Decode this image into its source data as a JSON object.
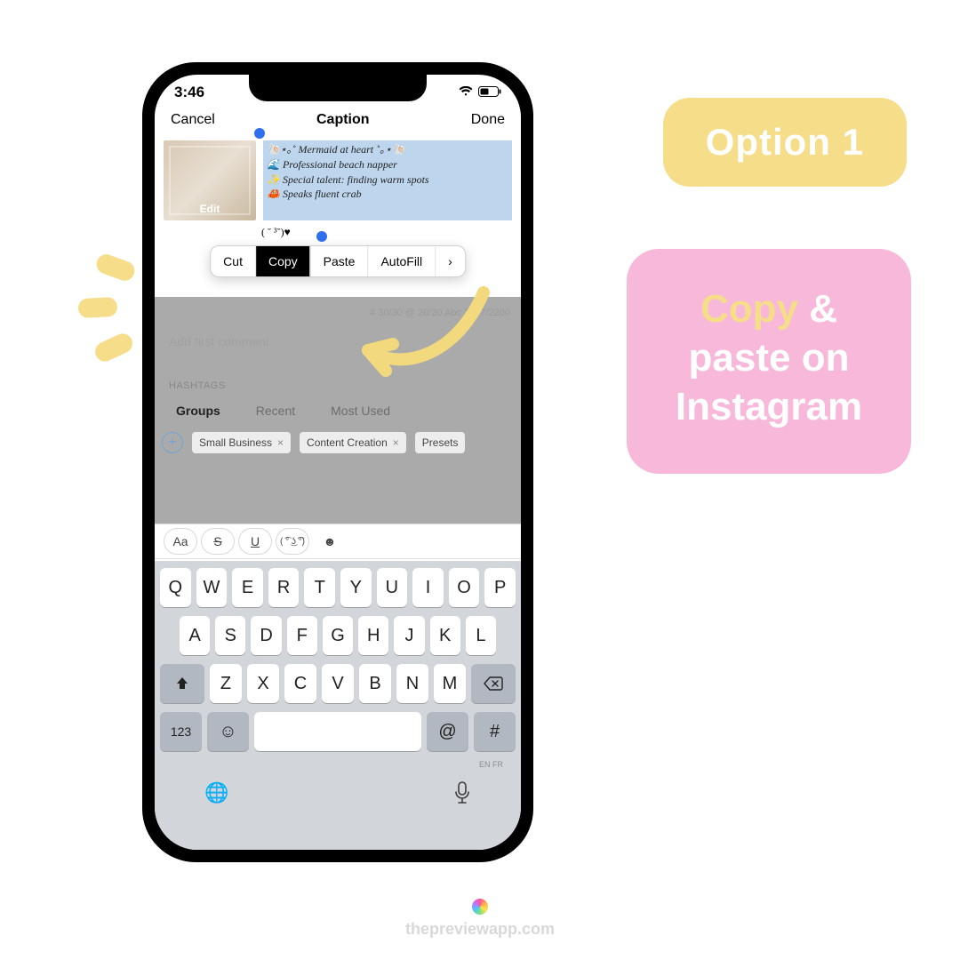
{
  "decor": {
    "badge": "Option 1",
    "pink": {
      "copy": "Copy",
      "amp": "&",
      "rest": "paste on Instagram"
    }
  },
  "status": {
    "time": "3:46"
  },
  "nav": {
    "cancel": "Cancel",
    "title": "Caption",
    "done": "Done"
  },
  "thumb": {
    "edit": "Edit"
  },
  "caption": {
    "line1": "🐚⋆｡˚ Mermaid at heart ˚｡⋆🐚",
    "line2": "🌊 Professional beach napper",
    "line3": "✨ Special talent: finding warm spots",
    "line4": "🦀 Speaks fluent crab",
    "extra": "( ˘ ³˘)♥"
  },
  "context": {
    "cut": "Cut",
    "copy": "Copy",
    "paste": "Paste",
    "autofill": "AutoFill",
    "more": "›"
  },
  "counters": "# 30/30   @ 20/20   Abc 1997/2200",
  "first_comment": "Add first comment",
  "hashtags": {
    "label": "HASHTAGS",
    "tabs": {
      "groups": "Groups",
      "recent": "Recent",
      "most": "Most Used"
    },
    "chips": [
      "Small Business",
      "Content Creation",
      "Presets"
    ]
  },
  "format": {
    "aa": "Aa",
    "strike": "S",
    "under": "U",
    "kaomoji": "( ͡° ͜ʖ ͡°)",
    "emoji": "☻"
  },
  "keyboard": {
    "r1": [
      "Q",
      "W",
      "E",
      "R",
      "T",
      "Y",
      "U",
      "I",
      "O",
      "P"
    ],
    "r2": [
      "A",
      "S",
      "D",
      "F",
      "G",
      "H",
      "J",
      "K",
      "L"
    ],
    "r3": [
      "Z",
      "X",
      "C",
      "V",
      "B",
      "N",
      "M"
    ],
    "num": "123",
    "at": "@",
    "hash": "#",
    "lang": "EN FR"
  },
  "watermark": "thepreviewapp.com"
}
